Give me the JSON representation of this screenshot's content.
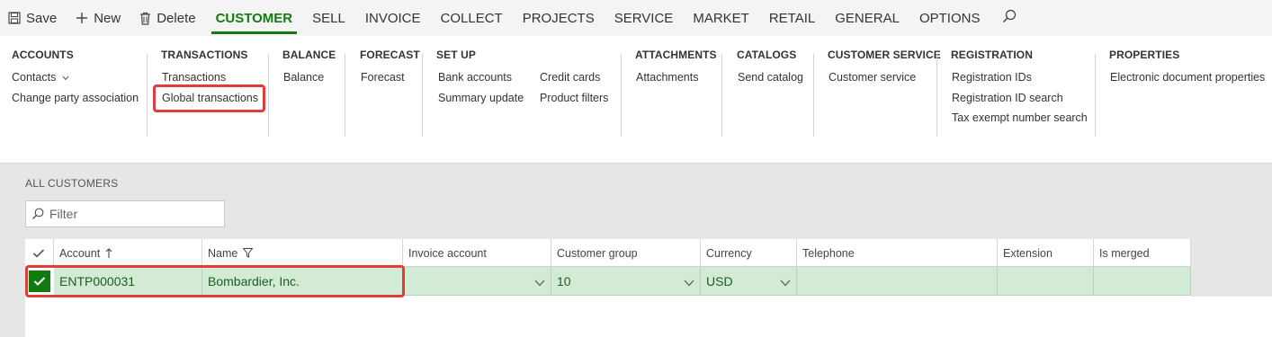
{
  "toolbar": {
    "save_label": "Save",
    "new_label": "New",
    "delete_label": "Delete",
    "tabs": [
      "CUSTOMER",
      "SELL",
      "INVOICE",
      "COLLECT",
      "PROJECTS",
      "SERVICE",
      "MARKET",
      "RETAIL",
      "GENERAL",
      "OPTIONS"
    ],
    "active_tab": "CUSTOMER"
  },
  "ribbon": {
    "accounts": {
      "title": "ACCOUNTS",
      "contacts": "Contacts",
      "change_party": "Change party association"
    },
    "transactions": {
      "title": "TRANSACTIONS",
      "transactions": "Transactions",
      "global_transactions": "Global transactions"
    },
    "balance": {
      "title": "BALANCE",
      "balance": "Balance"
    },
    "forecast": {
      "title": "FORECAST",
      "forecast": "Forecast"
    },
    "setup": {
      "title": "SET UP",
      "bank_accounts": "Bank accounts",
      "summary_update": "Summary update",
      "credit_cards": "Credit cards",
      "product_filters": "Product filters"
    },
    "attachments": {
      "title": "ATTACHMENTS",
      "attachments": "Attachments"
    },
    "catalogs": {
      "title": "CATALOGS",
      "send_catalog": "Send catalog"
    },
    "customer_service": {
      "title": "CUSTOMER SERVICE",
      "customer_service": "Customer service"
    },
    "registration": {
      "title": "REGISTRATION",
      "registration_ids": "Registration IDs",
      "registration_id_search": "Registration ID search",
      "tax_exempt": "Tax exempt number search"
    },
    "properties": {
      "title": "PROPERTIES",
      "electronic_doc": "Electronic document properties"
    }
  },
  "content": {
    "section_label": "ALL CUSTOMERS",
    "filter_placeholder": "Filter"
  },
  "grid": {
    "columns": [
      "Account",
      "Name",
      "Invoice account",
      "Customer group",
      "Currency",
      "Telephone",
      "Extension",
      "Is merged"
    ],
    "rows": [
      {
        "account": "ENTP000031",
        "name": "Bombardier, Inc.",
        "invoice_account": "",
        "customer_group": "10",
        "currency": "USD",
        "telephone": "",
        "extension": "",
        "is_merged": ""
      }
    ]
  },
  "colors": {
    "accent": "#107c10",
    "highlight": "#e03c3c",
    "selected_row": "#d3ead5"
  }
}
